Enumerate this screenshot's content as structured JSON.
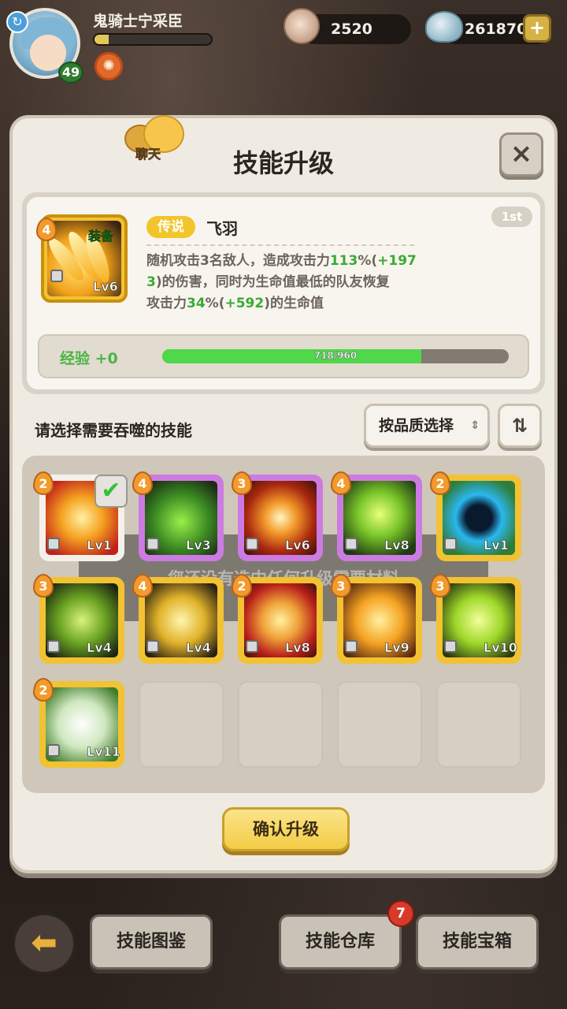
{
  "player": {
    "name": "鬼骑士宁采臣",
    "level": "49",
    "xp_fraction": 0.12
  },
  "resources": {
    "shells": "2520",
    "gems": "261870"
  },
  "panel": {
    "title": "技能升级",
    "chat_label": "聊天",
    "close": "×"
  },
  "skill": {
    "rank": "1st",
    "equip_tag": "装备",
    "star_level": "4",
    "level": "Lv6",
    "rarity": "传说",
    "name": "飞羽",
    "desc_line1_a": "随机攻击3名敌人，造成攻击力",
    "desc_line1_b": "113",
    "desc_line1_c": "%(",
    "desc_line1_d": "+197",
    "desc_line2_a": "3",
    "desc_line2_b": ")的伤害，同时为生命值最低的队友恢复",
    "desc_line3_a": "攻击力",
    "desc_line3_b": "34",
    "desc_line3_c": "%(",
    "desc_line3_d": "+592",
    "desc_line3_e": ")的生命值",
    "exp_label": "经验 +0",
    "exp_text": "718/960",
    "exp_fraction": 0.748
  },
  "select": {
    "label": "请选择需要吞噬的技能",
    "sort_label": "按品质选择",
    "caret": "▲▼",
    "order_icon": "sort-order-icon"
  },
  "materials": [
    {
      "star": "2",
      "level": "Lv1",
      "frame": "white",
      "art": "heal-cross",
      "selected": true
    },
    {
      "star": "4",
      "level": "Lv3",
      "frame": "purple",
      "art": "green-robot"
    },
    {
      "star": "3",
      "level": "Lv6",
      "frame": "purple",
      "art": "flame-drop"
    },
    {
      "star": "4",
      "level": "Lv8",
      "frame": "purple",
      "art": "glow-tree"
    },
    {
      "star": "2",
      "level": "Lv1",
      "frame": "gold",
      "art": "blue-vortex"
    },
    {
      "star": "3",
      "level": "Lv4",
      "frame": "gold",
      "art": "heart-sprout"
    },
    {
      "star": "4",
      "level": "Lv4",
      "frame": "gold",
      "art": "dark-robot"
    },
    {
      "star": "2",
      "level": "Lv8",
      "frame": "gold",
      "art": "red-swirl"
    },
    {
      "star": "3",
      "level": "Lv9",
      "frame": "gold",
      "art": "sprout-burst"
    },
    {
      "star": "3",
      "level": "Lv10",
      "frame": "gold",
      "art": "lime-burst"
    },
    {
      "star": "2",
      "level": "Lv11",
      "frame": "gold",
      "art": "white-owl"
    }
  ],
  "toast": "您还没有选中任何升级需要材料",
  "confirm": "确认升级",
  "bottom": {
    "back_icon": "back-arrow-icon",
    "codex": "技能图鉴",
    "storage": "技能仓库",
    "storage_badge": "7",
    "chest": "技能宝箱"
  },
  "colors": {
    "legend": "#f2c233",
    "epic": "#cc7be2",
    "green_text": "#3aaa34",
    "exp_fill": "#4fd84a"
  }
}
